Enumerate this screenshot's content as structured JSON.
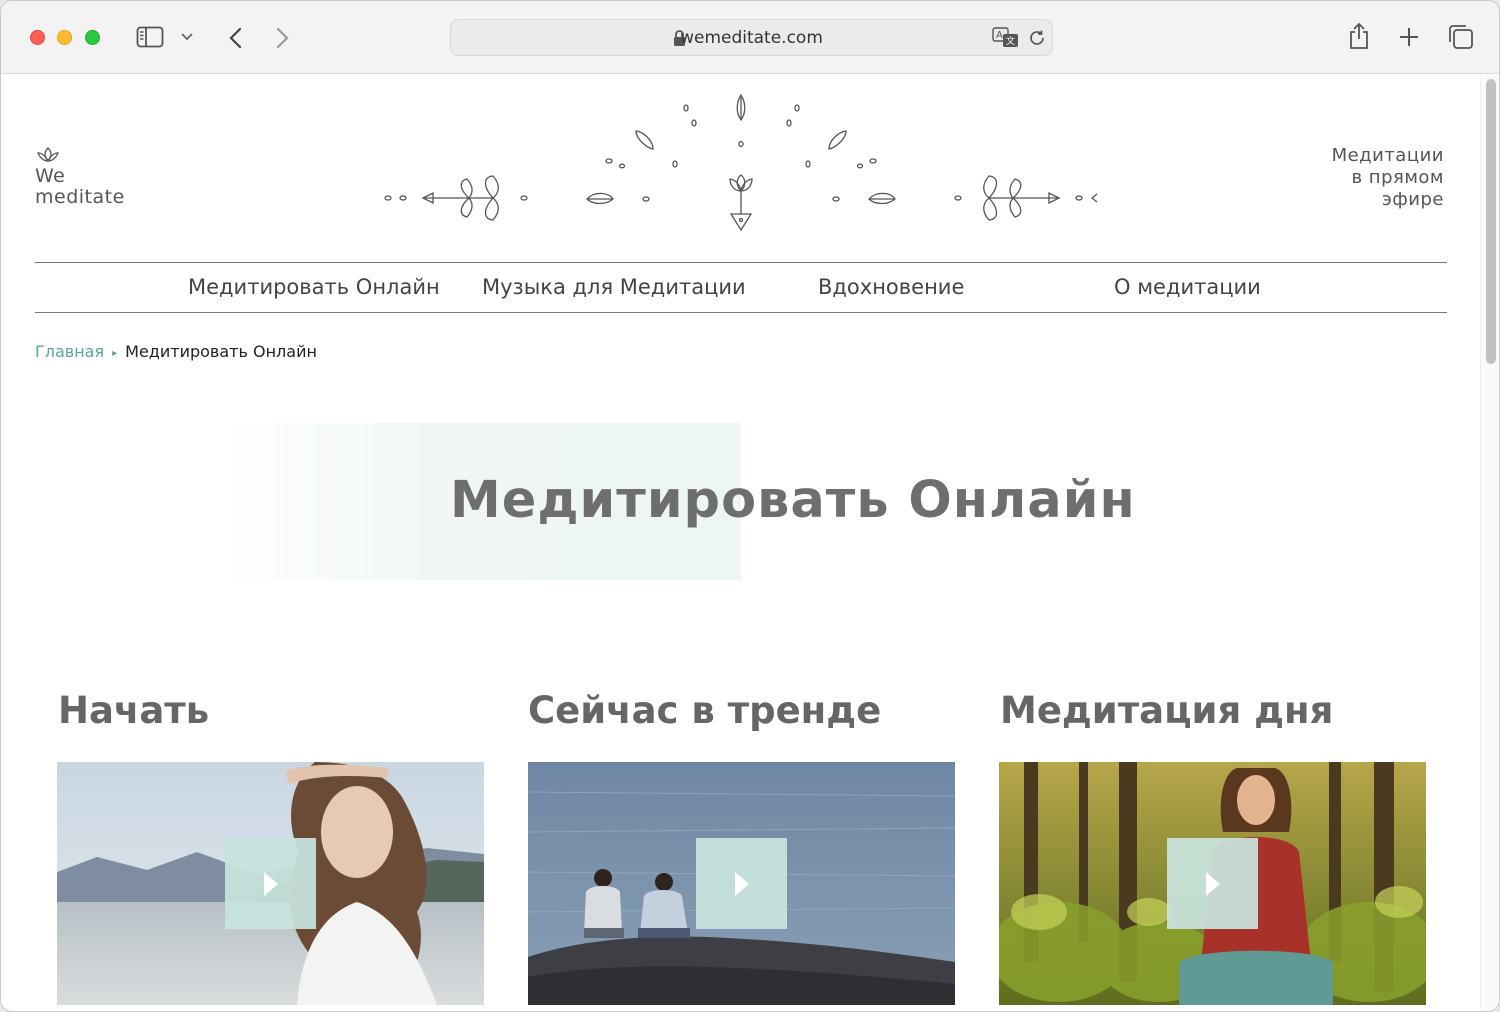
{
  "browser": {
    "url": "wemeditate.com",
    "icons": [
      "sidebar-icon",
      "chevron-down-icon",
      "back-icon",
      "forward-icon",
      "lock-icon",
      "translate-icon",
      "reload-icon",
      "share-icon",
      "plus-icon",
      "tabs-icon"
    ]
  },
  "site": {
    "logo_line1": "We",
    "logo_line2": "meditate",
    "live_line1": "Медитации",
    "live_line2": "в прямом",
    "live_line3": "эфире"
  },
  "nav": {
    "items": [
      {
        "label": "Медитировать Онлайн"
      },
      {
        "label": "Музыка для Медитации"
      },
      {
        "label": "Вдохновение"
      },
      {
        "label": "О медитации"
      }
    ]
  },
  "breadcrumb": {
    "home": "Главная",
    "current": "Медитировать Онлайн"
  },
  "hero": {
    "title": "Медитировать Онлайн"
  },
  "sections": [
    {
      "title": "Начать"
    },
    {
      "title": "Сейчас в тренде"
    },
    {
      "title": "Медитация дня"
    }
  ],
  "colors": {
    "accent": "#5aa69c",
    "play_bg": "#c8e4de"
  }
}
